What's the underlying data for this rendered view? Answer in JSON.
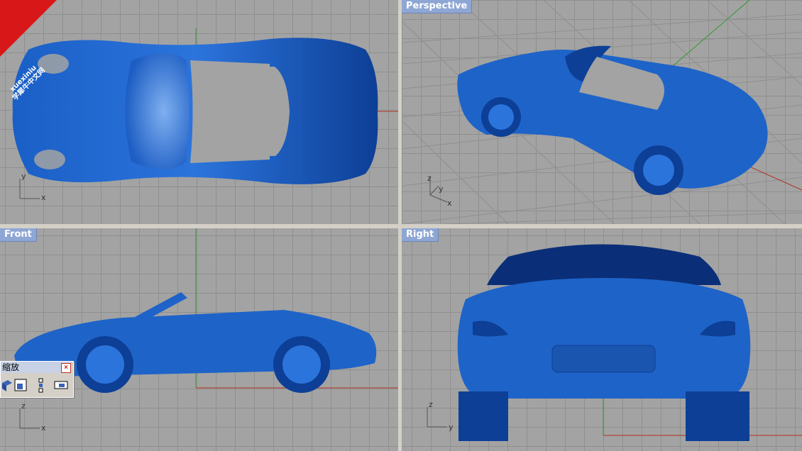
{
  "viewports": {
    "top": {
      "title": "",
      "axes": {
        "v": "y",
        "h": "x"
      }
    },
    "perspective": {
      "title": "Perspective",
      "axes": {
        "v": "z",
        "m": "y",
        "h": "x"
      }
    },
    "front": {
      "title": "Front",
      "axes": {
        "v": "z",
        "h": "x"
      }
    },
    "right": {
      "title": "Right",
      "axes": {
        "v": "z",
        "h": "y"
      }
    }
  },
  "toolbar": {
    "title": "缩放",
    "close": "×",
    "icons": [
      "zoom-window-icon",
      "zoom-extents-icon",
      "zoom-selected-icon",
      "zoom-dynamic-icon"
    ]
  },
  "watermark": {
    "line1": "xuexiniu",
    "line2": "学犀牛中文网"
  },
  "colors": {
    "grid": "#a3a3a3",
    "model": "#1e63c8",
    "x_axis": "#b03020",
    "y_axis": "#2a9a2a",
    "title_bg": "#8ea6d4"
  }
}
